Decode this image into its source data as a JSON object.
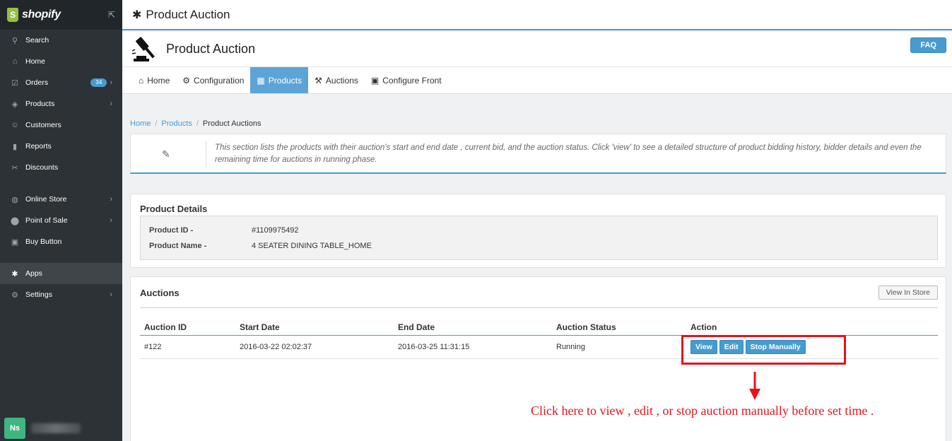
{
  "sidebar": {
    "logo_text": "shopify",
    "items": [
      {
        "label": "Search"
      },
      {
        "label": "Home"
      },
      {
        "label": "Orders",
        "badge": "34"
      },
      {
        "label": "Products"
      },
      {
        "label": "Customers"
      },
      {
        "label": "Reports"
      },
      {
        "label": "Discounts"
      },
      {
        "label": "Online Store"
      },
      {
        "label": "Point of Sale"
      },
      {
        "label": "Buy Button"
      },
      {
        "label": "Apps"
      },
      {
        "label": "Settings"
      }
    ],
    "footer_avatar": "Ns"
  },
  "topbar": {
    "title": "Product Auction"
  },
  "app": {
    "title": "Product Auction",
    "faq_label": "FAQ",
    "tabs": [
      {
        "label": "Home"
      },
      {
        "label": "Configuration"
      },
      {
        "label": "Products"
      },
      {
        "label": "Auctions"
      },
      {
        "label": "Configure Front"
      }
    ]
  },
  "breadcrumb": [
    "Home",
    "Products",
    "Product Auctions"
  ],
  "info_text": "This section lists the products with their auction's start and end date , current bid, and the auction status. Click 'view' to see a detailed structure of product bidding history, bidder details and even the remaining time for auctions in running phase.",
  "product_details": {
    "title": "Product Details",
    "id_label": "Product ID -",
    "id_value": "#1109975492",
    "name_label": "Product Name -",
    "name_value": "4 SEATER DINING TABLE_HOME"
  },
  "auctions": {
    "title": "Auctions",
    "view_in_store": "View In Store",
    "columns": [
      "Auction ID",
      "Start Date",
      "End Date",
      "Auction Status",
      "Action"
    ],
    "rows": [
      {
        "id": "#122",
        "start": "2016-03-22 02:02:37",
        "end": "2016-03-25 11:31:15",
        "status": "Running"
      }
    ],
    "actions": [
      "View",
      "Edit",
      "Stop Manually"
    ]
  },
  "annotation": "Click here to view , edit , or stop auction manually before set time .",
  "colors": {
    "accent": "#479ccf",
    "annotation": "#e8121a",
    "sidebar": "#2c3236"
  }
}
